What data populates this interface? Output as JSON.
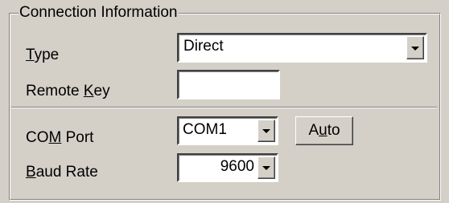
{
  "group": {
    "title": "Connection Information"
  },
  "type_field": {
    "label_key": "T",
    "label_rest": "ype",
    "value": "Direct"
  },
  "remote_key_field": {
    "label_pre": "Remote ",
    "label_key": "K",
    "label_rest": "ey",
    "value": ""
  },
  "com_port_field": {
    "label_pre": "CO",
    "label_key": "M",
    "label_rest": " Port",
    "value": "COM1"
  },
  "baud_rate_field": {
    "label_key": "B",
    "label_rest": "aud Rate",
    "value": "9600"
  },
  "auto_button": {
    "label_pre": "A",
    "label_key": "u",
    "label_rest": "to"
  },
  "icons": {
    "dropdown": "chevron-down-icon"
  }
}
